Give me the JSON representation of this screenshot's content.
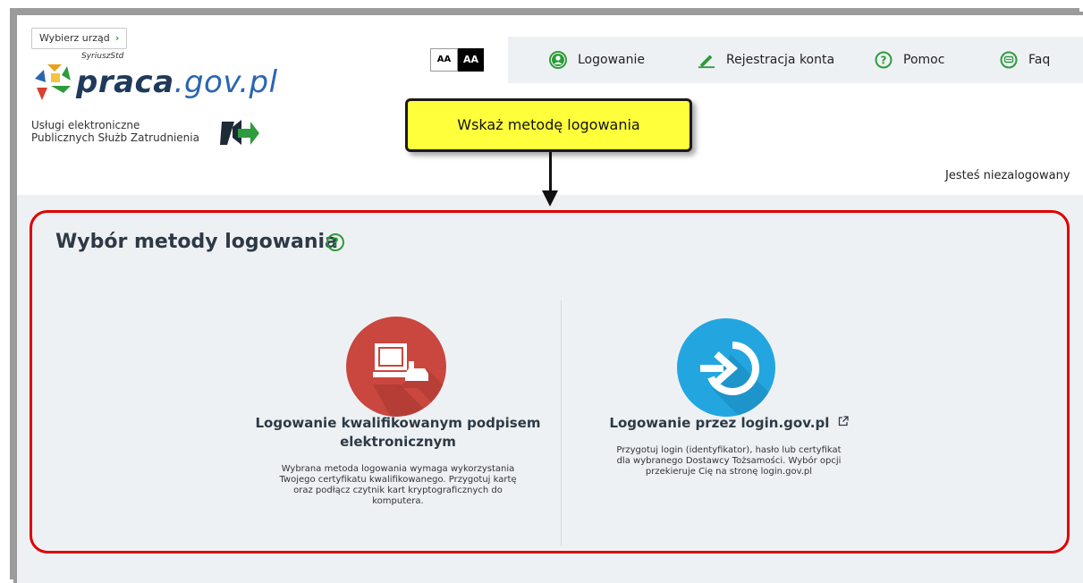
{
  "header": {
    "choose_office": "Wybierz urząd",
    "choose_office_chevron": "›",
    "logo_small": "SyriuszStd",
    "logo_main_a": "praca",
    "logo_main_b": ".gov.pl",
    "services_line1": "Usługi elektroniczne",
    "services_line2": "Publicznych Służb Zatrudnienia",
    "font_small": "AA",
    "font_large": "AA"
  },
  "nav": {
    "items": [
      {
        "label": "Logowanie",
        "icon": "user-icon"
      },
      {
        "label": "Rejestracja konta",
        "icon": "pencil-icon"
      },
      {
        "label": "Pomoc",
        "icon": "help-icon"
      },
      {
        "label": "Faq",
        "icon": "chat-icon"
      }
    ]
  },
  "callout": {
    "text": "Wskaż metodę logowania"
  },
  "status": {
    "text": "Jesteś niezalogowany"
  },
  "main": {
    "title": "Wybór metody logowania",
    "methods": [
      {
        "title_line1": "Logowanie kwalifikowanym podpisem",
        "title_line2": "elektronicznym",
        "desc_lines": [
          "Wybrana metoda logowania wymaga wykorzystania",
          "Twojego certyfikatu kwalifikowanego. Przygotuj kartę",
          "oraz podłącz czytnik kart kryptograficznych do",
          "komputera."
        ],
        "icon": "computer-card-reader-icon"
      },
      {
        "title": "Logowanie przez login.gov.pl",
        "desc_lines": [
          "Przygotuj login (identyfikator), hasło lub certyfikat",
          "dla wybranego Dostawcy Tożsamości. Wybór opcji",
          "przekieruje Cię na stronę login.gov.pl"
        ],
        "icon": "login-arrow-icon"
      }
    ]
  },
  "colors": {
    "accent_green": "#2e9b3c",
    "highlight_red": "#e00000",
    "callout_yellow": "#ffff3c",
    "icon_red": "#c9473e",
    "icon_blue": "#23a6e0"
  }
}
